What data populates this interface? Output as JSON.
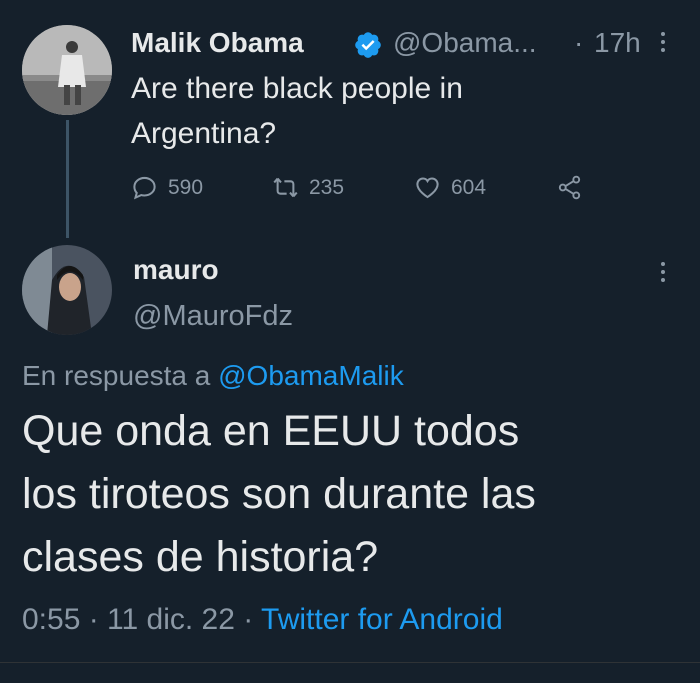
{
  "tweet1": {
    "name": "Malik Obama",
    "handle": "@Obama...",
    "separator": "·",
    "time": "17h",
    "text_line1": "Are there black people in",
    "text_line2": "Argentina?",
    "replies": "590",
    "retweets": "235",
    "likes": "604"
  },
  "tweet2": {
    "name": "mauro",
    "handle": "@MauroFdz",
    "reply_prefix": "En respuesta a",
    "reply_to": "@ObamaMalik",
    "text_line1": "Que onda en EEUU todos",
    "text_line2": "los tiroteos son durante las",
    "text_line3": "clases de historia?",
    "timestamp": "0:55 · 11 dic. 22 ·",
    "source": "Twitter for Android"
  },
  "colors": {
    "background": "#15202b",
    "accent": "#1d9bf0",
    "muted": "#8b98a5"
  }
}
